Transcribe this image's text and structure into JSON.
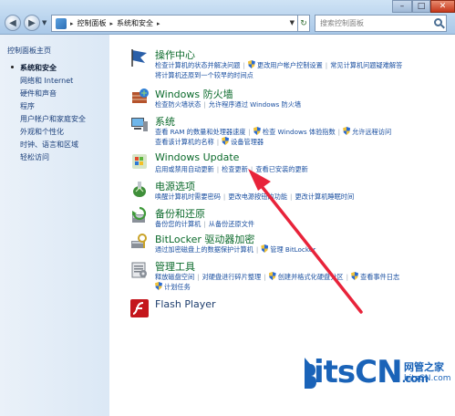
{
  "titlebar": {
    "breadcrumbs": [
      "控制面板",
      "系统和安全"
    ],
    "search_placeholder": "搜索控制面板"
  },
  "sidebar": {
    "home": "控制面板主页",
    "items": [
      {
        "label": "系统和安全",
        "active": true
      },
      {
        "label": "网络和 Internet"
      },
      {
        "label": "硬件和声音"
      },
      {
        "label": "程序"
      },
      {
        "label": "用户帐户和家庭安全"
      },
      {
        "label": "外观和个性化"
      },
      {
        "label": "时钟、语言和区域"
      },
      {
        "label": "轻松访问"
      }
    ]
  },
  "categories": [
    {
      "title": "操作中心",
      "icon": "flag-icon",
      "lines": [
        [
          {
            "t": "检查计算机的状态并解决问题"
          },
          {
            "t": "更改用户帐户控制设置",
            "shield": true
          },
          {
            "t": "常见计算机问题疑难解答"
          }
        ],
        [
          {
            "t": "将计算机还原到一个较早的时间点"
          }
        ]
      ]
    },
    {
      "title": "Windows 防火墙",
      "icon": "firewall-icon",
      "lines": [
        [
          {
            "t": "检查防火墙状态"
          },
          {
            "t": "允许程序通过 Windows 防火墙"
          }
        ]
      ]
    },
    {
      "title": "系统",
      "icon": "computer-icon",
      "lines": [
        [
          {
            "t": "查看 RAM 的数量和处理器速度"
          },
          {
            "t": "检查 Windows 体验指数",
            "shield": true
          },
          {
            "t": "允许远程访问",
            "shield": true
          }
        ],
        [
          {
            "t": "查看该计算机的名称"
          },
          {
            "t": "设备管理器",
            "shield": true
          }
        ]
      ]
    },
    {
      "title": "Windows Update",
      "icon": "windows-update-icon",
      "lines": [
        [
          {
            "t": "启用或禁用自动更新"
          },
          {
            "t": "检查更新"
          },
          {
            "t": "查看已安装的更新"
          }
        ]
      ]
    },
    {
      "title": "电源选项",
      "icon": "power-icon",
      "lines": [
        [
          {
            "t": "唤醒计算机时需要密码"
          },
          {
            "t": "更改电源按钮的功能"
          },
          {
            "t": "更改计算机睡眠时间"
          }
        ]
      ]
    },
    {
      "title": "备份和还原",
      "icon": "backup-icon",
      "lines": [
        [
          {
            "t": "备份您的计算机"
          },
          {
            "t": "从备份还原文件"
          }
        ]
      ]
    },
    {
      "title": "BitLocker 驱动器加密",
      "icon": "bitlocker-icon",
      "lines": [
        [
          {
            "t": "通过加密磁盘上的数据保护计算机"
          },
          {
            "t": "管理 BitLocker",
            "shield": true
          }
        ]
      ]
    },
    {
      "title": "管理工具",
      "icon": "admin-tools-icon",
      "lines": [
        [
          {
            "t": "释放磁盘空间"
          },
          {
            "t": "对硬盘进行碎片整理"
          },
          {
            "t": "创建并格式化硬盘分区",
            "shield": true
          },
          {
            "t": "查看事件日志",
            "shield": true
          }
        ],
        [
          {
            "t": "计划任务",
            "shield": true
          }
        ]
      ]
    },
    {
      "title": "Flash Player",
      "icon": "flash-icon",
      "lines": []
    }
  ],
  "watermark": {
    "logo_a": "itsCN",
    "logo_b": ".com",
    "site_line1": "网管之家",
    "site_line2": "bitsCN.com"
  },
  "colors": {
    "link": "#1a4fa0",
    "category_title": "#0b6a2b",
    "arrow": "#e8233a"
  }
}
